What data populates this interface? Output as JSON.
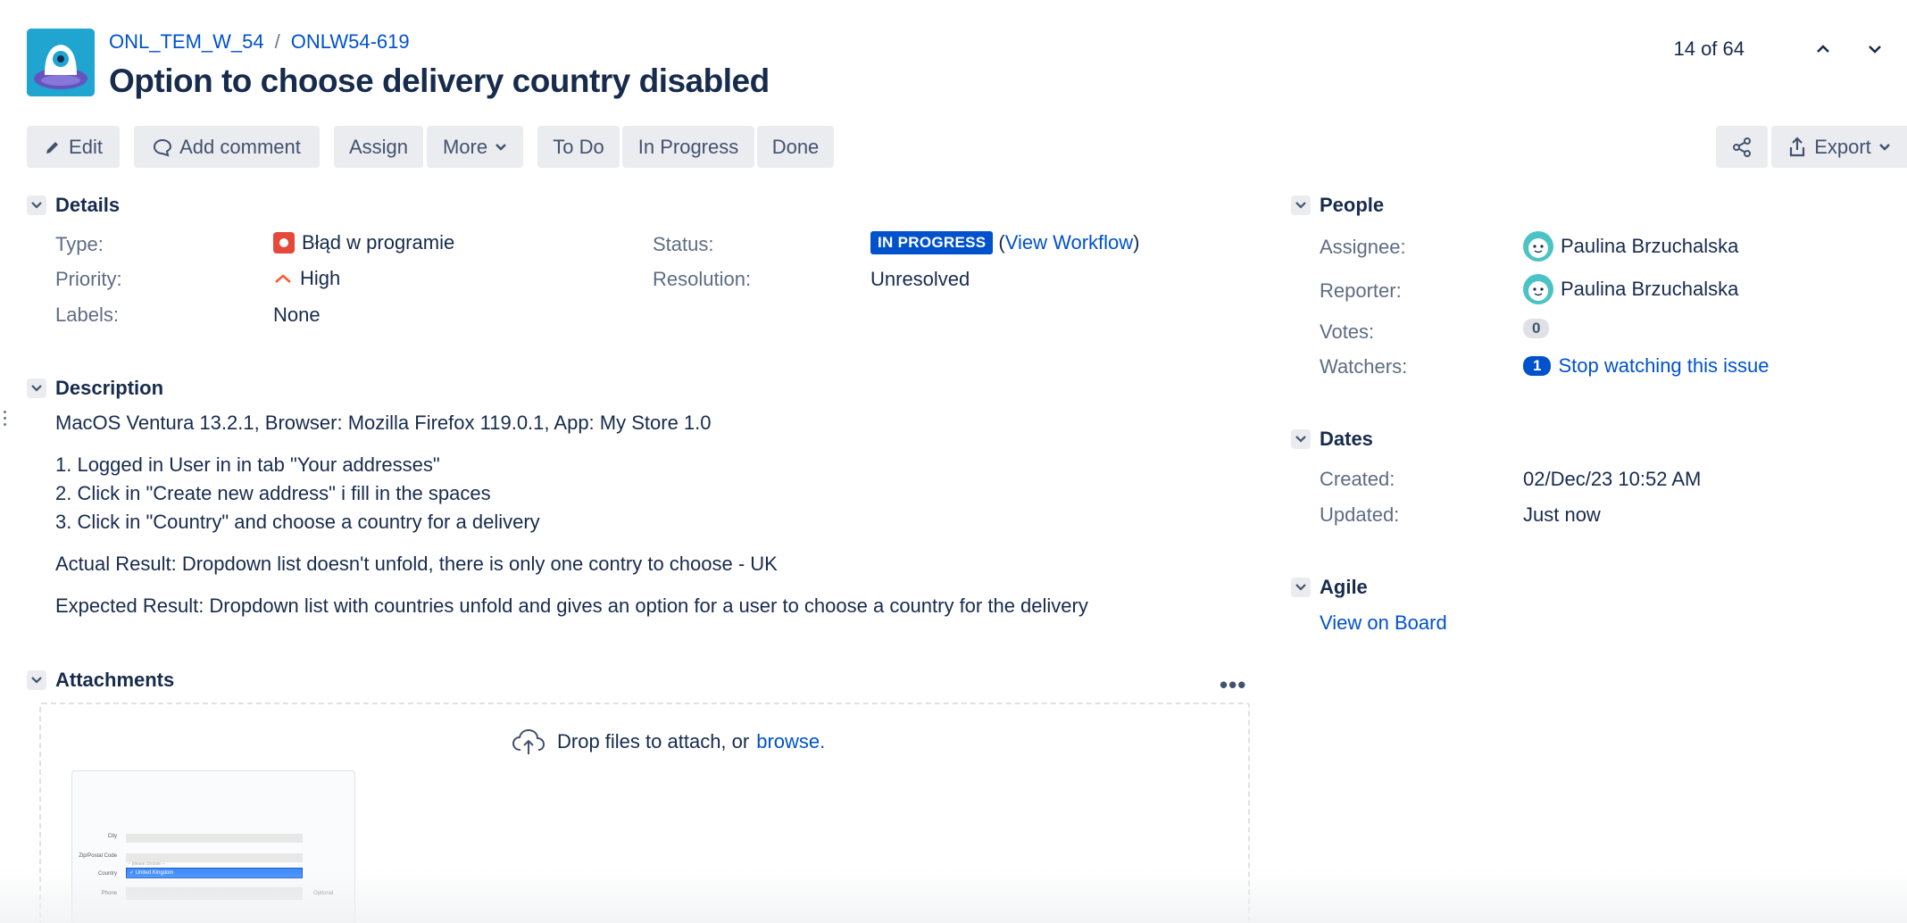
{
  "header": {
    "project": "ONL_TEM_W_54",
    "issue_key": "ONLW54-619",
    "title": "Option to choose delivery country disabled",
    "pager": "14 of 64",
    "avatar_color": "#1fa5cf"
  },
  "toolbar": {
    "edit": "Edit",
    "add_comment": "Add comment",
    "assign": "Assign",
    "more": "More",
    "todo": "To Do",
    "in_progress": "In Progress",
    "done": "Done",
    "export": "Export"
  },
  "details": {
    "heading": "Details",
    "type_label": "Type:",
    "type_value": "Błąd w programie",
    "priority_label": "Priority:",
    "priority_value": "High",
    "labels_label": "Labels:",
    "labels_value": "None",
    "status_label": "Status:",
    "status_value": "IN PROGRESS",
    "view_workflow": "View Workflow",
    "resolution_label": "Resolution:",
    "resolution_value": "Unresolved"
  },
  "description": {
    "heading": "Description",
    "env": "MacOS Ventura 13.2.1, Browser: Mozilla Firefox 119.0.1, App: My Store 1.0",
    "steps": [
      "1.  Logged in User in in tab \"Your addresses\"",
      "2. Click in \"Create new address\" i fill in the spaces",
      "3. Click in \"Country\" and choose a country for a delivery"
    ],
    "actual": "Actual Result: Dropdown list doesn't unfold, there is only one contry to choose - UK",
    "expected": "Expected Result: Dropdown list with countries unfold and gives an option for a user to choose a country for the delivery"
  },
  "attachments": {
    "heading": "Attachments",
    "drop_text": "Drop files to attach, or",
    "browse": "browse.",
    "thumb_fields": [
      "City",
      "Zip/Postal Code",
      "Country",
      "Phone"
    ],
    "thumb_option_faded": "-- please choose --",
    "thumb_option": "✓ United Kingdom",
    "thumb_optional": "Optional"
  },
  "people": {
    "heading": "People",
    "assignee_label": "Assignee:",
    "assignee": "Paulina Brzuchalska",
    "reporter_label": "Reporter:",
    "reporter": "Paulina Brzuchalska",
    "votes_label": "Votes:",
    "votes": "0",
    "watchers_label": "Watchers:",
    "watchers": "1",
    "stop_watching": "Stop watching this issue"
  },
  "dates": {
    "heading": "Dates",
    "created_label": "Created:",
    "created": "02/Dec/23 10:52 AM",
    "updated_label": "Updated:",
    "updated": "Just now"
  },
  "agile": {
    "heading": "Agile",
    "view_on_board": "View on Board"
  },
  "colors": {
    "link": "#0052cc",
    "status_blue": "#0052cc",
    "bug_red": "#e5493a",
    "button_bg": "#ebecf0"
  }
}
